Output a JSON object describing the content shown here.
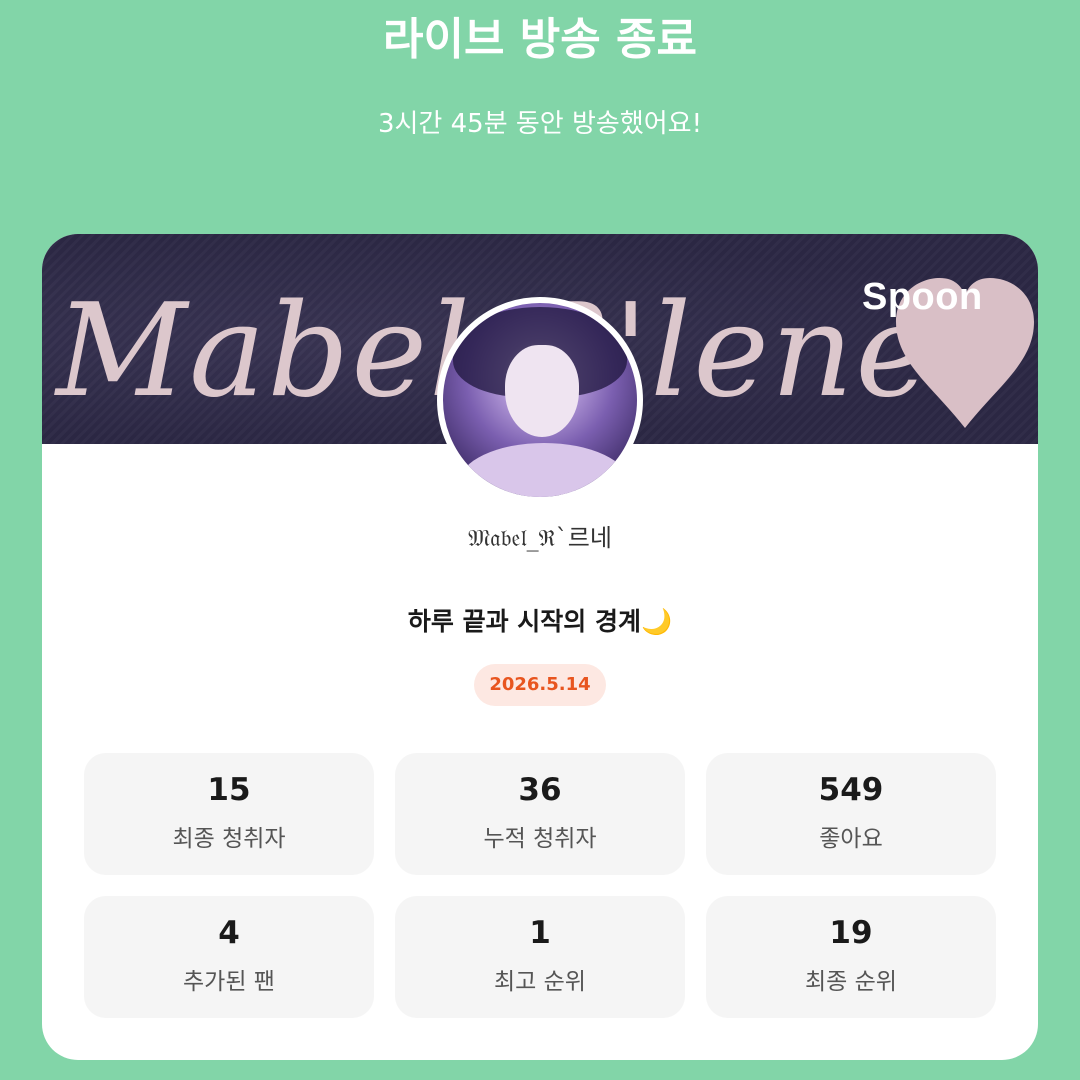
{
  "header": {
    "title": "라이브 방송 종료",
    "subtitle": "3시간 45분 동안 방송했어요!"
  },
  "card": {
    "banner_text": "Mabel R'lene",
    "brand_logo": "Spoon",
    "avatar_icon": "profile-photo",
    "nickname": "𝔐𝔞𝔟𝔢𝔩_ℜ`르네",
    "live_title": "하루 끝과 시작의 경계🌙",
    "date": "2026.5.14"
  },
  "stats": [
    {
      "value": "15",
      "label": "최종 청취자"
    },
    {
      "value": "36",
      "label": "누적 청취자"
    },
    {
      "value": "549",
      "label": "좋아요"
    },
    {
      "value": "4",
      "label": "추가된 팬"
    },
    {
      "value": "1",
      "label": "최고 순위"
    },
    {
      "value": "19",
      "label": "최종 순위"
    }
  ],
  "colors": {
    "background": "#82d5a8",
    "banner": "#2c2845",
    "banner_script": "#dcc7cc",
    "date_badge_bg": "#fde8e2",
    "date_badge_text": "#e8551f",
    "stat_card_bg": "#f5f5f5"
  }
}
